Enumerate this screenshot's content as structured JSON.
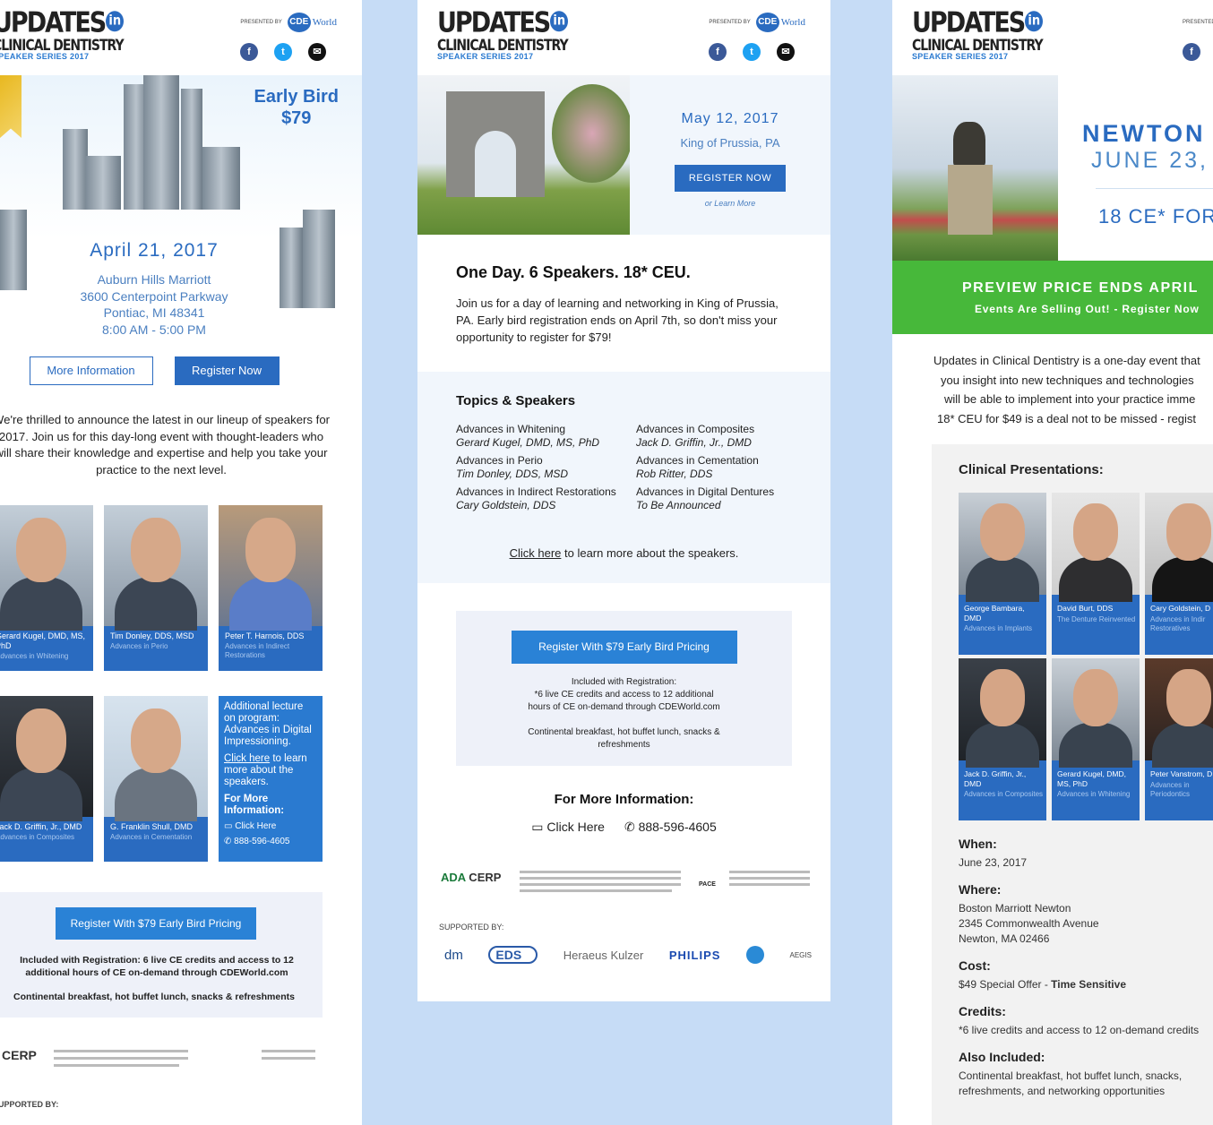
{
  "common": {
    "logo_line1": "UPDATES",
    "logo_in": "in",
    "logo_line2": "CLINICAL DENTISTRY",
    "logo_line3": "SPEAKER SERIES 2017",
    "presented_by": "PRESENTED BY",
    "cde": "CDE",
    "cde_world": "World",
    "fb": "f",
    "tw": "t",
    "em": "✉"
  },
  "p1": {
    "early_bird": "Early Bird",
    "price": "$79",
    "date": "April 21, 2017",
    "address": [
      "Auburn Hills Marriott",
      "3600 Centerpoint Parkway",
      "Pontiac, MI 48341",
      "8:00 AM - 5:00 PM"
    ],
    "more_info": "More Information",
    "register": "Register Now",
    "intro": "We're thrilled to announce the latest in our lineup of speakers for 2017. Join us for this day-long event with thought-leaders who will share their knowledge and expertise and help you take your practice to the next level.",
    "speakers": [
      {
        "name": "Gerard Kugel, DMD, MS, PhD",
        "topic": "Advances in Whitening"
      },
      {
        "name": "Tim Donley, DDS, MSD",
        "topic": "Advances in Perio"
      },
      {
        "name": "Peter T. Harnois, DDS",
        "topic": "Advances in Indirect Restorations"
      },
      {
        "name": "Jack D. Griffin, Jr., DMD",
        "topic": "Advances in Composites"
      },
      {
        "name": "G. Franklin Shull, DMD",
        "topic": "Advances in Cementation"
      }
    ],
    "addl_text": "Additional lecture on program: Advances in Digital Impressioning.",
    "addl_click": "Click here",
    "addl_rest": " to learn more about the speakers.",
    "addl_more": "For More Information:",
    "addl_clickhere": "Click Here",
    "addl_phone": "888-596-4605",
    "reg_btn": "Register With $79 Early Bird Pricing",
    "included": "Included with Registration: 6 live CE credits and access to 12 additional hours of CE on-demand through CDEWorld.com",
    "breakfast": "Continental breakfast, hot buffet lunch, snacks & refreshments",
    "cerp": "CERP",
    "supported": "SUPPORTED BY:"
  },
  "p2": {
    "date": "May 12, 2017",
    "location": "King of Prussia, PA",
    "register": "REGISTER NOW",
    "learn_more": "or Learn More",
    "headline": "One Day. 6 Speakers. 18* CEU.",
    "body": "Join us for a day of learning and networking in King of Prussia, PA. Early bird registration ends on April 7th, so don't miss your opportunity to register for $79!",
    "topics_title": "Topics & Speakers",
    "topics": [
      {
        "topic": "Advances in Whitening",
        "speaker": "Gerard Kugel, DMD, MS, PhD"
      },
      {
        "topic": "Advances in Composites",
        "speaker": "Jack D. Griffin, Jr., DMD"
      },
      {
        "topic": "Advances in Perio",
        "speaker": "Tim Donley, DDS, MSD"
      },
      {
        "topic": "Advances in Cementation",
        "speaker": "Rob Ritter, DDS"
      },
      {
        "topic": "Advances in Indirect Restorations",
        "speaker": "Cary Goldstein, DDS"
      },
      {
        "topic": "Advances in Digital Dentures",
        "speaker": "To Be Announced"
      }
    ],
    "click_here": "Click here",
    "click_rest": " to learn more about the speakers.",
    "reg_btn": "Register With $79 Early Bird Pricing",
    "included_1": "Included with Registration:",
    "included_2": "*6 live CE credits and access to 12 additional",
    "included_3": "hours of CE on-demand through CDEWorld.com",
    "breakfast_1": "Continental breakfast, hot buffet lunch, snacks &",
    "breakfast_2": "refreshments",
    "more_title": "For More Information:",
    "click": "Click Here",
    "phone": "888-596-4605",
    "ada": "ADA",
    "cerp": " CERP",
    "pace": "PACE",
    "supported": "SUPPORTED BY:",
    "sponsors": [
      "dm",
      "EDS",
      "Heraeus Kulzer",
      "PHILIPS",
      "AEGIS"
    ]
  },
  "p3": {
    "city": "NEWTON",
    "date": "JUNE 23,",
    "ce": "18 CE* FOR",
    "preview": "PREVIEW PRICE ENDS APRIL",
    "selling": "Events Are Selling Out! - Register Now",
    "intro": [
      "Updates in Clinical Dentistry is a one-day event that",
      "you insight into new techniques and technologies",
      "will be able to implement into your practice imme",
      "18* CEU for $49 is a deal not to be missed - regist"
    ],
    "clinical_title": "Clinical Presentations:",
    "speakers": [
      {
        "name": "George Bambara, DMD",
        "topic": "Advances in Implants"
      },
      {
        "name": "David Burt, DDS",
        "topic": "The Denture Reinvented"
      },
      {
        "name": "Cary Goldstein, D",
        "topic": "Advances in Indir Restoratives"
      },
      {
        "name": "Jack D. Griffin, Jr., DMD",
        "topic": "Advances in Composites"
      },
      {
        "name": "Gerard Kugel, DMD, MS, PhD",
        "topic": "Advances in Whitening"
      },
      {
        "name": "Peter Vanstrom, D",
        "topic": "Advances in Periodontics"
      }
    ],
    "when_label": "When:",
    "when": "June 23, 2017",
    "where_label": "Where:",
    "where": [
      "Boston Marriott Newton",
      "2345 Commonwealth Avenue",
      "Newton, MA 02466"
    ],
    "cost_label": "Cost:",
    "cost": "$49 Special Offer - ",
    "cost_bold": "Time Sensitive",
    "credits_label": "Credits:",
    "credits": "*6 live credits and access to 12 on-demand credits",
    "also_label": "Also Included:",
    "also": [
      "Continental breakfast, hot buffet lunch, snacks,",
      "refreshments, and networking opportunities"
    ]
  },
  "colors": {
    "brand": "#2a6bc0",
    "green": "#47b83a",
    "bg": "#c6dcf6"
  }
}
